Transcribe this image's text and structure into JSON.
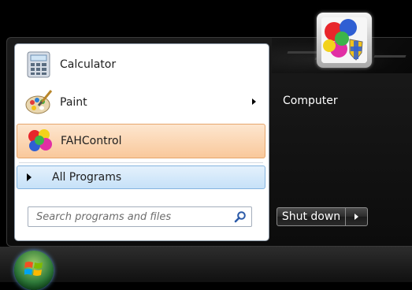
{
  "programs": [
    {
      "label": "Calculator",
      "icon": "calculator-icon",
      "has_submenu": false
    },
    {
      "label": "Paint",
      "icon": "paint-palette-icon",
      "has_submenu": true
    },
    {
      "label": "FAHControl",
      "icon": "fahcontrol-icon",
      "has_submenu": false,
      "highlighted": true
    }
  ],
  "all_programs": {
    "label": "All Programs"
  },
  "search": {
    "placeholder": "Search programs and files",
    "value": ""
  },
  "right_panel": {
    "links": [
      "Computer"
    ]
  },
  "shutdown": {
    "label": "Shut down"
  },
  "colors": {
    "highlight_bg": "#f9c89b",
    "all_programs_bg": "#c6e1f8",
    "menu_frame": "#101010",
    "panel_bg": "#ffffff"
  }
}
